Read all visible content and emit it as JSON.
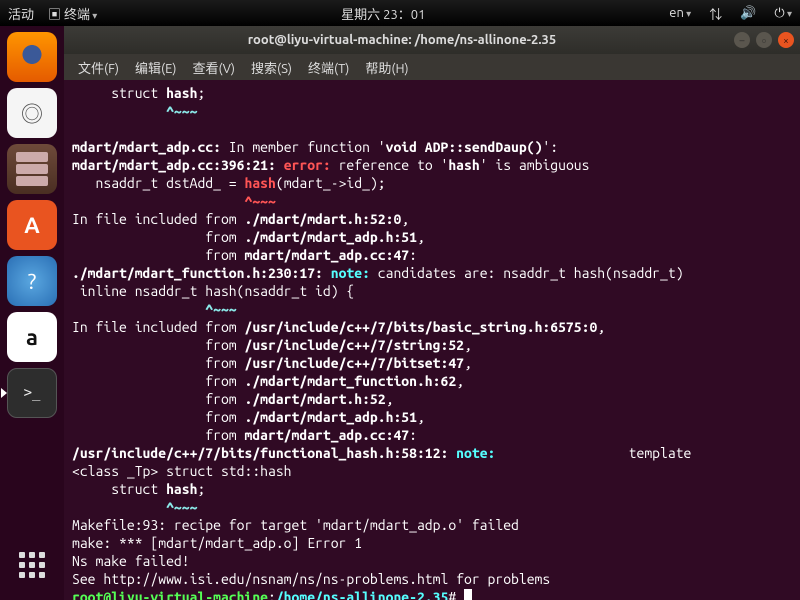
{
  "topbar": {
    "activities": "活动",
    "appmenu": "终端",
    "clock": "星期六 23：01",
    "lang": "en",
    "net_icon": "network-icon",
    "sound_icon": "sound-icon",
    "power_icon": "power-icon"
  },
  "launcher": {
    "firefox": "firefox",
    "rhythmbox": "rhythmbox",
    "files": "files",
    "software": "ubuntu-software",
    "help": "help",
    "amazon": "amazon",
    "terminal": "terminal",
    "apps": "show-applications"
  },
  "window": {
    "title": "root@liyu-virtual-machine: /home/ns-allinone-2.35",
    "menu": {
      "file": "文件(F)",
      "edit": "编辑(E)",
      "view": "查看(V)",
      "search": "搜索(S)",
      "terminal": "终端(T)",
      "help": "帮助(H)"
    }
  },
  "t": {
    "l1a": "     struct ",
    "l1b": "hash",
    "l1c": ";",
    "l2": "            ^~~~",
    "l3a": "mdart/mdart_adp.cc:",
    "l3b": " In member function '",
    "l3c": "void ADP::sendDaup()",
    "l3d": "':",
    "l4a": "mdart/mdart_adp.cc:396:21: ",
    "l4b": "error:",
    "l4c": " reference to '",
    "l4d": "hash",
    "l4e": "' is ambiguous",
    "l5a": "   nsaddr_t dstAdd_ = ",
    "l5b": "hash",
    "l5c": "(mdart_->id_);",
    "l6": "                      ^~~~",
    "l7a": "In file included from ",
    "l7b": "./mdart/mdart.h:52:0",
    "l7c": ",",
    "l8a": "                 from ",
    "l8b": "./mdart/mdart_adp.h:51",
    "l8c": ",",
    "l9a": "                 from ",
    "l9b": "mdart/mdart_adp.cc:47",
    "l9c": ":",
    "l10a": "./mdart/mdart_function.h:230:17:",
    "l10b": " note:",
    "l10c": " candidates are: nsaddr_t hash(nsaddr_t)",
    "l11": " inline nsaddr_t hash(nsaddr_t id) {",
    "l12": "                 ^~~~",
    "l13a": "In file included from ",
    "l13b": "/usr/include/c++/7/bits/basic_string.h:6575:0",
    "l13c": ",",
    "l14a": "                 from ",
    "l14b": "/usr/include/c++/7/string:52",
    "l14c": ",",
    "l15a": "                 from ",
    "l15b": "/usr/include/c++/7/bitset:47",
    "l15c": ",",
    "l16a": "                 from ",
    "l16b": "./mdart/mdart_function.h:62",
    "l16c": ",",
    "l17a": "                 from ",
    "l17b": "./mdart/mdart.h:52",
    "l17c": ",",
    "l18a": "                 from ",
    "l18b": "./mdart/mdart_adp.h:51",
    "l18c": ",",
    "l19a": "                 from ",
    "l19b": "mdart/mdart_adp.cc:47",
    "l19c": ":",
    "l20a": "/usr/include/c++/7/bits/functional_hash.h:58:12:",
    "l20b": " note:",
    "l20c": "                 template",
    "l21": "<class _Tp> struct std::hash",
    "l22a": "     struct ",
    "l22b": "hash",
    "l22c": ";",
    "l23": "            ^~~~",
    "l24": "Makefile:93: recipe for target 'mdart/mdart_adp.o' failed",
    "l25": "make: *** [mdart/mdart_adp.o] Error 1",
    "l26": "Ns make failed!",
    "l27": "See http://www.isi.edu/nsnam/ns/ns-problems.html for problems",
    "l28a": "root@liyu-virtual-machine",
    "l28b": ":",
    "l28c": "/home/ns-allinone-2.35",
    "l28d": "# "
  }
}
